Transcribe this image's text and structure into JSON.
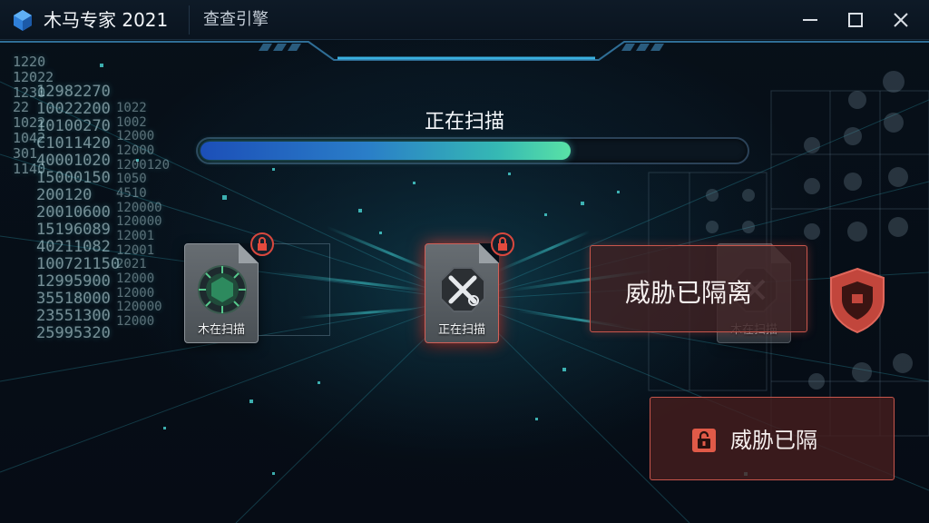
{
  "window": {
    "app_title": "木马专家 2021",
    "tab_label": "查查引擎",
    "controls": {
      "minimize": "minimize",
      "maximize": "maximize",
      "close": "close"
    }
  },
  "scan": {
    "status_title": "正在扫描",
    "progress": 0.68,
    "progress_colors": [
      "#1c4fb8",
      "#59e2a6"
    ]
  },
  "cards": [
    {
      "label": "木在扫描",
      "icon": "virus-icon",
      "badge": "lock-icon"
    },
    {
      "label": "正在扫描",
      "icon": "crossed-tools-icon",
      "badge": "lock-icon",
      "state": "alert"
    },
    {
      "label": "木在扫描",
      "icon": "file-icon"
    }
  ],
  "threat": {
    "quarantine_text": "威胁已隔离",
    "button_label": "威胁已隔",
    "button_icon": "lock-icon",
    "shield_icon": "shield-icon",
    "accent_color": "#d9483e"
  },
  "code_stream": {
    "left_col_a": [
      "1220",
      "12022",
      "1230",
      "22",
      "1022",
      "1042",
      "301",
      "1140"
    ],
    "left_col_b": [
      "12982270",
      "10022200",
      "10100270",
      "C1011420",
      "40001020",
      "15000150",
      "200120",
      "20010600",
      "15196089",
      "40211082",
      "100721150",
      "12995900",
      "35518000",
      "23551300",
      "25995320"
    ],
    "mid_col": [
      "1022",
      "1002",
      "12000",
      "12000",
      "1200120",
      "1050",
      "4510",
      "120000",
      "120000",
      "12001",
      "12001",
      "2021",
      "12000",
      "12000",
      "120000",
      "12000"
    ]
  }
}
